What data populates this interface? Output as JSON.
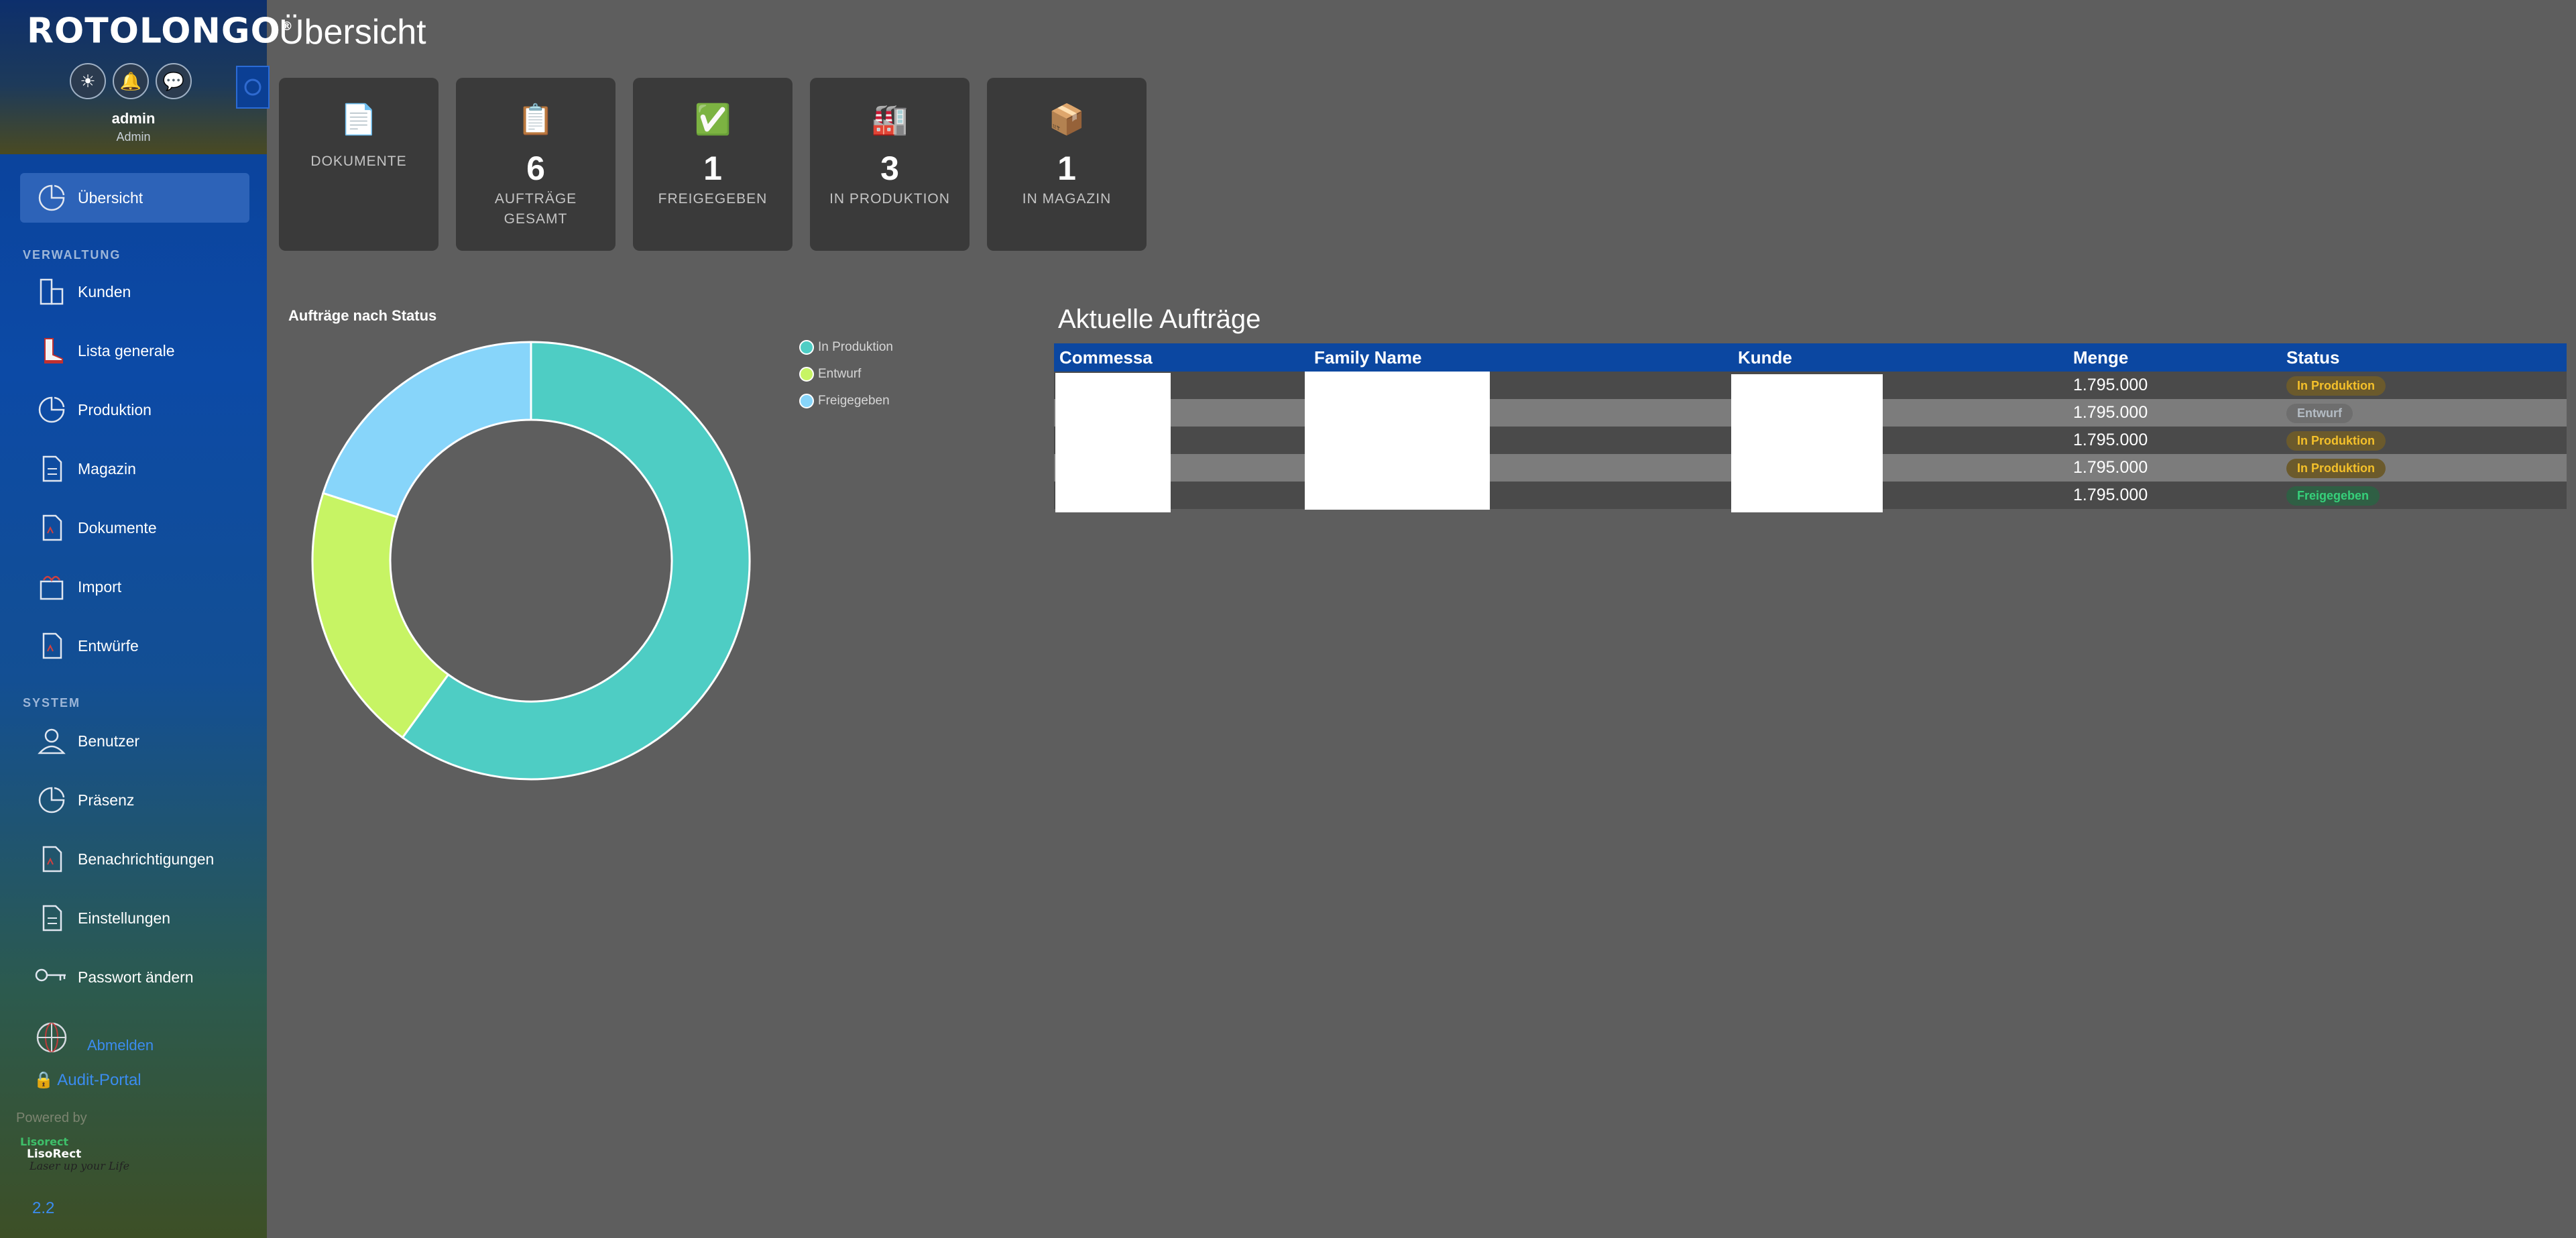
{
  "app": {
    "brand": "ROTOLONGO",
    "brand_mark": "®",
    "user": {
      "name": "admin",
      "role": "Admin"
    },
    "header_icons": [
      "sun-icon",
      "bell-icon",
      "chat-icon"
    ]
  },
  "sidebar": {
    "main": [
      {
        "label": "Übersicht",
        "icon": "dashboard-icon",
        "active": true
      }
    ],
    "sections": [
      {
        "title": "VERWALTUNG",
        "items": [
          {
            "label": "Kunden",
            "icon": "building-icon"
          },
          {
            "label": "Lista generale",
            "icon": "boot-icon"
          },
          {
            "label": "Produktion",
            "icon": "pie-icon"
          },
          {
            "label": "Magazin",
            "icon": "document-icon"
          },
          {
            "label": "Dokumente",
            "icon": "document-icon"
          },
          {
            "label": "Import",
            "icon": "import-icon"
          },
          {
            "label": "Entwürfe",
            "icon": "document-icon"
          }
        ]
      },
      {
        "title": "SYSTEM",
        "items": [
          {
            "label": "Benutzer",
            "icon": "user-icon"
          },
          {
            "label": "Präsenz",
            "icon": "pie-icon"
          },
          {
            "label": "Benachrichtigungen",
            "icon": "document-icon"
          },
          {
            "label": "Einstellungen",
            "icon": "document-icon"
          },
          {
            "label": "Passwort ändern",
            "icon": "key-icon"
          }
        ]
      }
    ],
    "logout": "Abmelden",
    "audit": "Audit-Portal",
    "audit_icon": "🔒",
    "powered_by": "Powered by",
    "partner_logo": {
      "name": "Lisorect",
      "alt": "LisoRect",
      "tagline": "Laser up your Life"
    },
    "version": "2.2"
  },
  "page": {
    "title": "Übersicht"
  },
  "cards": [
    {
      "icon": "📄",
      "icon_name": "document-icon",
      "value": "",
      "label": "DOKUMENTE"
    },
    {
      "icon": "📋",
      "icon_name": "clipboard-icon",
      "value": "6",
      "label": "AUFTRÄGE GESAMT"
    },
    {
      "icon": "✅",
      "icon_name": "check-icon",
      "value": "1",
      "label": "FREIGEGEBEN"
    },
    {
      "icon": "🏭",
      "icon_name": "factory-icon",
      "value": "3",
      "label": "IN PRODUKTION"
    },
    {
      "icon": "📦",
      "icon_name": "package-icon",
      "value": "1",
      "label": "IN MAGAZIN"
    }
  ],
  "chart_data": {
    "type": "pie",
    "variant": "doughnut",
    "title": "Aufträge nach Status",
    "legend_position": "top-right",
    "categories": [
      "In Produktion",
      "Entwurf",
      "Freigegeben"
    ],
    "values": [
      3,
      1,
      1
    ],
    "colors": [
      "#4ecdc4",
      "#c7f464",
      "#87d5fa"
    ]
  },
  "orders": {
    "title": "Aktuelle Aufträge",
    "columns": [
      "Commessa",
      "Family Name",
      "Kunde",
      "Menge",
      "Status"
    ],
    "rows": [
      {
        "commessa": "",
        "family": "",
        "kunde": "",
        "menge": "1.795.000",
        "status": "In Produktion"
      },
      {
        "commessa": "",
        "family": "",
        "kunde": "",
        "menge": "1.795.000",
        "status": "Entwurf"
      },
      {
        "commessa": "",
        "family": "",
        "kunde": "",
        "menge": "1.795.000",
        "status": "In Produktion"
      },
      {
        "commessa": "",
        "family": "",
        "kunde": "",
        "menge": "1.795.000",
        "status": "In Produktion"
      },
      {
        "commessa": "",
        "family": "",
        "kunde": "",
        "menge": "1.795.000",
        "status": "Freigegeben"
      }
    ],
    "status_colors": {
      "In Produktion": {
        "bg": "#6b5a2c",
        "fg": "#f4c02a"
      },
      "Entwurf": {
        "bg": "#6e6e6e",
        "fg": "#b4bcc4"
      },
      "Freigegeben": {
        "bg": "#2f5f44",
        "fg": "#36d07a"
      }
    }
  }
}
